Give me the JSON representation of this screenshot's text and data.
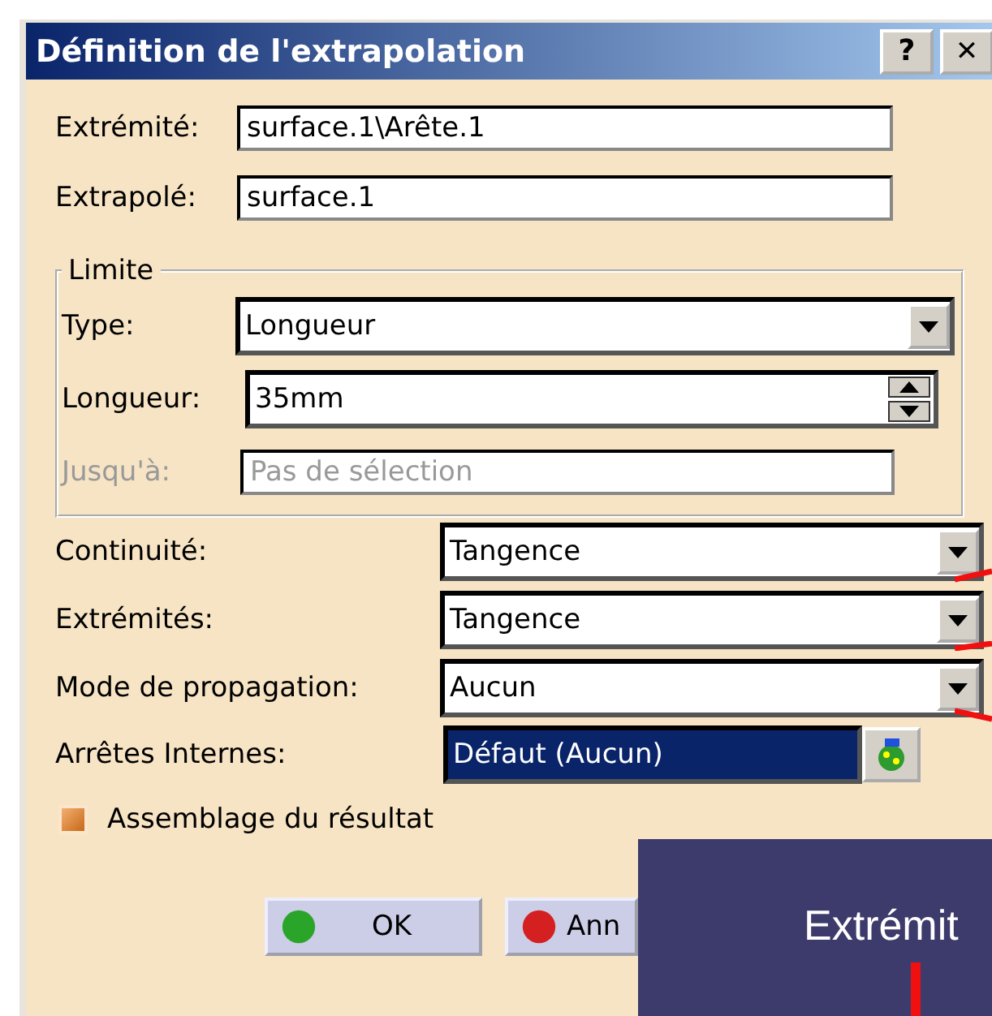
{
  "window": {
    "title": "Définition de l'extrapolation",
    "buttons": [
      {
        "kind": "help",
        "label": "?"
      },
      {
        "kind": "close",
        "label": "✕"
      }
    ]
  },
  "top_fields": [
    {
      "label": "Extrémité:",
      "value": "surface.1\\Arête.1"
    },
    {
      "label": "Extrapolé:",
      "value": "surface.1"
    }
  ],
  "limit_group": {
    "title": "Limite",
    "rows": [
      {
        "kind": "dropdown",
        "label": "Type:",
        "value": "Longueur",
        "disabled": false
      },
      {
        "kind": "spin",
        "label": "Longueur:",
        "value": "35mm",
        "disabled": false
      },
      {
        "kind": "field",
        "label": "Jusqu'à:",
        "placeholder": "Pas de sélection",
        "disabled": true
      }
    ]
  },
  "options": [
    {
      "kind": "dropdown",
      "label": "Continuité:",
      "value": "Tangence"
    },
    {
      "kind": "dropdown",
      "label": "Extrémités:",
      "value": "Tangence"
    },
    {
      "kind": "dropdown",
      "label": "Mode de propagation:",
      "value": "Aucun"
    },
    {
      "kind": "selection",
      "label": "Arrêtes Internes:",
      "value": "Défaut (Aucun)"
    }
  ],
  "checkbox": {
    "label": "Assemblage du résultat",
    "checked": false
  },
  "buttons": [
    {
      "kind": "ok",
      "label": "OK"
    },
    {
      "kind": "cancel",
      "label": "Ann"
    }
  ],
  "callout": {
    "text": "Extrémit"
  }
}
